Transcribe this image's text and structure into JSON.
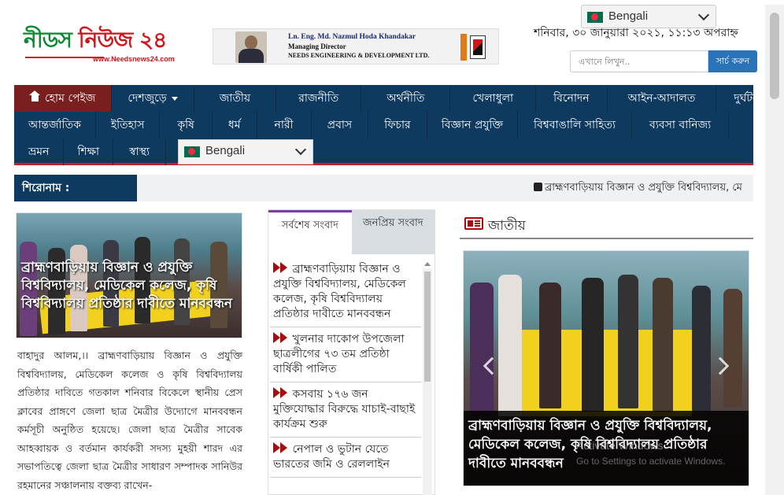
{
  "header": {
    "logo": {
      "name_part1": "নীডস",
      "name_part2": "নিউজ ২৪",
      "url": "www.Needsnews24.com"
    },
    "ad": {
      "line1": "Ln. Eng. Md. Nazmul Hoda Khandakar",
      "line2": "Managing Director",
      "line3": "NEEDS ENGINEERING & DEVELOPMENT LTD."
    },
    "date": "শনিবার, ৩০ জানুয়ারী ২০২১, ১১:১৩ অপরাহ্ন",
    "language_top": "Bengali",
    "search": {
      "placeholder": "এখানে লিখুন..",
      "button": "সার্চ করুন"
    }
  },
  "nav": {
    "row1": [
      "হোম পেইজ",
      "দেশজুড়ে",
      "জাতীয়",
      "রাজনীতি",
      "অর্থনীতি",
      "খেলাধুলা",
      "বিনোদন",
      "আইন-আদালত",
      "দুর্ঘটনা"
    ],
    "row2": [
      "আন্তর্জাতিক",
      "ইতিহাস",
      "কৃষি",
      "ধর্ম",
      "নারী",
      "প্রবাস",
      "ফিচার",
      "বিজ্ঞান প্রযুক্তি",
      "বিশ্ববাঙালি সাহিত্য",
      "ব্যবসা বানিজ্য"
    ],
    "row3": [
      "ভ্রমন",
      "শিক্ষা",
      "স্বাস্থ্য"
    ],
    "language": "Bengali"
  },
  "ticker": {
    "label": "শিরোনাম :",
    "text": "ব্রাহ্মণবাড়িয়ায় বিজ্ঞান ও প্রযুক্তি বিশ্ববিদ্যালয়, মে"
  },
  "lead": {
    "caption": "ব্রাহ্মণবাড়িয়ায় বিজ্ঞান ও প্রযুক্তি বিশ্ববিদ্যালয়, মেডিকেল কলেজ, কৃষি বিশ্ববিদ্যালয় প্রতিষ্ঠার দাবীতে মানববন্ধন",
    "body": "বাহাদুর আলম,।। ব্রাহ্মণবাড়িয়ায় বিজ্ঞান ও প্রযুক্তি বিশ্ববিদ্যালয়, মেডিকেল কলেজ ও কৃষি বিশ্ববিদ্যালয় প্রতিষ্ঠার দাবিতে গতকাল শনিবার বিকেলে স্থানীয় প্রেস ক্লাবের প্রাঙ্গণে জেলা ছাত্র মৈত্রীর উদ্যোগে মানববন্ধন কর্মসূচী অনুষ্ঠিত হয়েছে। জেলা ছাত্র মৈত্রীর সাবেক আহব্বায়ক ও বর্তমান কার্যকরী সদস্য মুহয়ী শারদ এর সভাপতিত্বে জেলা ছাত্র মৈত্রীর সাধারণ সম্পাদক সানিউর রহমানের সঞ্চালনায় বক্তব্য রাখেন-"
  },
  "tabs": {
    "latest": "সর্বশেষ সংবাদ",
    "popular": "জনপ্রিয় সংবাদ"
  },
  "latest_news": [
    "ব্রাহ্মণবাড়িয়ায় বিজ্ঞান ও প্রযুক্তি বিশ্ববিদ্যালয়, মেডিকেল কলেজ, কৃষি বিশ্ববিদ্যালয় প্রতিষ্ঠার দাবীতে মানববন্ধন",
    "খুলনার দাকোপ উপজেলা ছাত্রলীগের ৭৩ তম প্রতিষ্ঠা বার্ষিকী পালিত",
    "কসবায় ১৭৬ জন মুক্তিযোদ্ধার বিরুদ্ধে যাচাই-বাছাই কার্যক্রম শুরু",
    "নেপাল ও ভুটান যেতে ভারতের জমি ও রেললাইন"
  ],
  "national": {
    "title": "জাতীয়",
    "caption": "ব্রাহ্মণবাড়িয়ায় বিজ্ঞান ও প্রযুক্তি বিশ্ববিদ্যালয়, মেডিকেল কলেজ, কৃষি বিশ্ববিদ্যালয় প্রতিষ্ঠার দাবীতে মানববন্ধন"
  },
  "watermark": {
    "line1": "Activate Windows",
    "line2": "Go to Settings to activate Windows."
  },
  "colors": {
    "nav_bg": "#0f3a5f",
    "accent_red": "#c62026",
    "home_bg": "#7a1f1f",
    "logo_green": "#0a8a2e",
    "search_btn": "#2a73b8"
  }
}
